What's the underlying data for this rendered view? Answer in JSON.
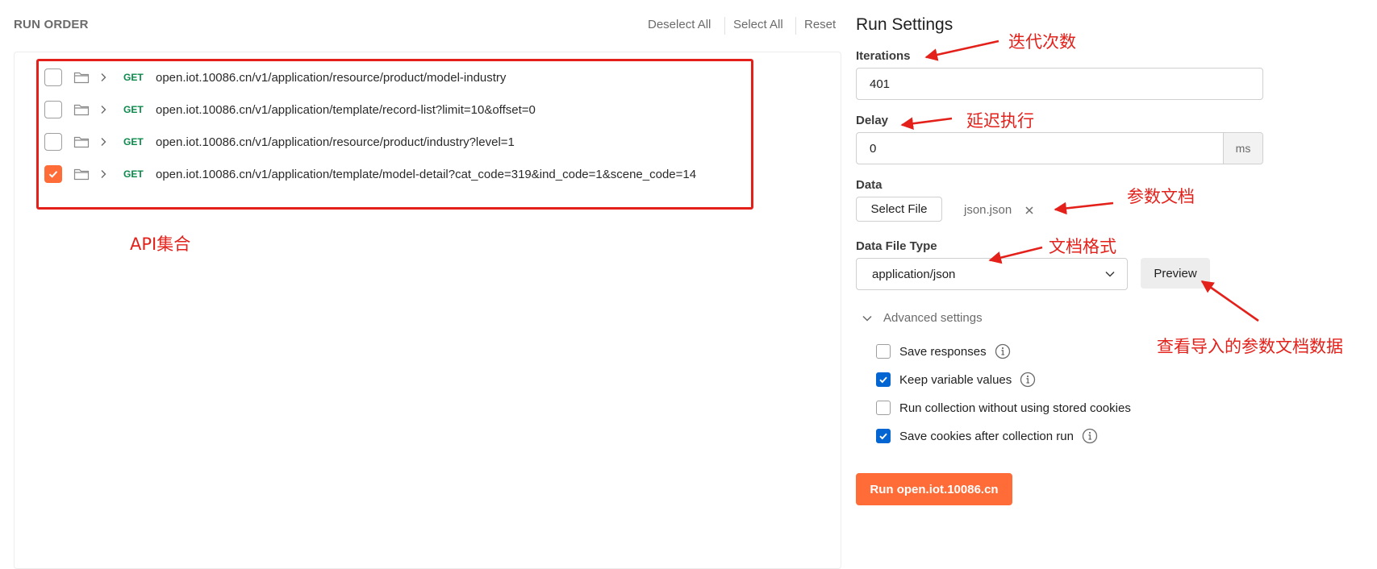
{
  "run_order": {
    "title": "RUN ORDER",
    "deselect_all": "Deselect All",
    "select_all": "Select All",
    "reset": "Reset",
    "requests": [
      {
        "method": "GET",
        "url": "open.iot.10086.cn/v1/application/resource/product/model-industry",
        "checked": false
      },
      {
        "method": "GET",
        "url": "open.iot.10086.cn/v1/application/template/record-list?limit=10&offset=0",
        "checked": false
      },
      {
        "method": "GET",
        "url": "open.iot.10086.cn/v1/application/resource/product/industry?level=1",
        "checked": false
      },
      {
        "method": "GET",
        "url": "open.iot.10086.cn/v1/application/template/model-detail?cat_code=319&ind_code=1&scene_code=14",
        "checked": true
      }
    ]
  },
  "run_settings": {
    "title": "Run Settings",
    "iterations_label": "Iterations",
    "iterations_value": "401",
    "delay_label": "Delay",
    "delay_value": "0",
    "delay_unit": "ms",
    "data_label": "Data",
    "select_file_label": "Select File",
    "file_name": "json.json",
    "data_file_type_label": "Data File Type",
    "data_file_type_value": "application/json",
    "preview_label": "Preview",
    "advanced_label": "Advanced settings",
    "options": [
      {
        "label": "Save responses",
        "checked": false,
        "info": true
      },
      {
        "label": "Keep variable values",
        "checked": true,
        "info": true
      },
      {
        "label": "Run collection without using stored cookies",
        "checked": false,
        "info": false
      },
      {
        "label": "Save cookies after collection run",
        "checked": true,
        "info": true
      }
    ],
    "run_button_label": "Run open.iot.10086.cn"
  },
  "annotations": {
    "api_collection": "API集合",
    "iterations": "迭代次数",
    "delay": "延迟执行",
    "param_doc": "参数文档",
    "doc_format": "文档格式",
    "preview_data": "查看导入的参数文档数据"
  },
  "colors": {
    "accent": "#ff6c37",
    "annotation_red": "#e3201a",
    "checkbox_blue": "#0265d2",
    "get_green": "#0b8a4a"
  },
  "icons": {
    "folder": "folder-icon",
    "chevron": "chevron-right-icon",
    "check": "check-icon",
    "close": "close-icon",
    "dropdown": "chevron-down-icon",
    "info": "info-icon"
  }
}
